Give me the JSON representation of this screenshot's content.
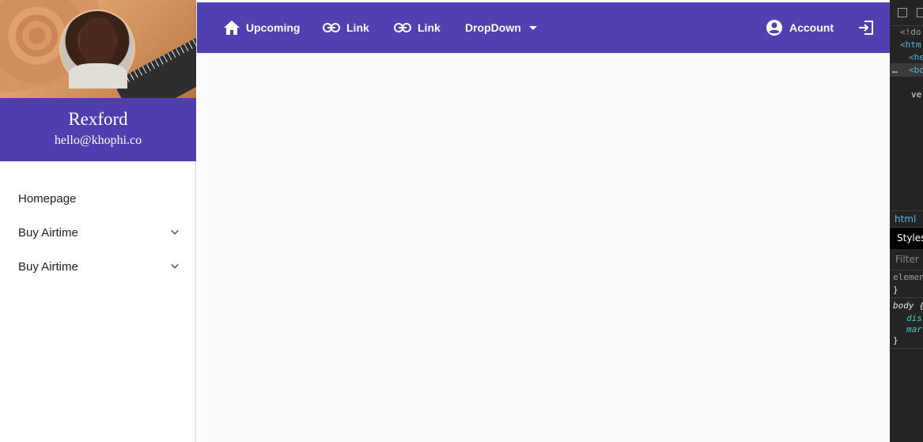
{
  "profile": {
    "name": "Rexford",
    "email": "hello@khophi.co"
  },
  "sidebar": {
    "items": [
      {
        "label": "Homepage",
        "expandable": false
      },
      {
        "label": "Buy Airtime",
        "expandable": true
      },
      {
        "label": "Buy Airtime",
        "expandable": true
      }
    ]
  },
  "topbar": {
    "home_label": "Upcoming",
    "link1_label": "Link",
    "link2_label": "Link",
    "dropdown_label": "DropDown",
    "account_label": "Account"
  },
  "devtools": {
    "lines": [
      "<!do",
      "<htm",
      "<he",
      "<bo",
      "ve"
    ],
    "crumb": "html",
    "tab": "Styles",
    "filter_placeholder": "Filter",
    "rule1_selector": "elemen",
    "rule1_close": "}",
    "rule2_selector": "body {",
    "rule2_prop1": "dis",
    "rule2_prop2": "mar",
    "rule2_close": "}"
  },
  "colors": {
    "primary": "#5040b0",
    "profile_band": "#4f3eb0",
    "background": "#fafafa",
    "devtools_bg": "#242424"
  }
}
